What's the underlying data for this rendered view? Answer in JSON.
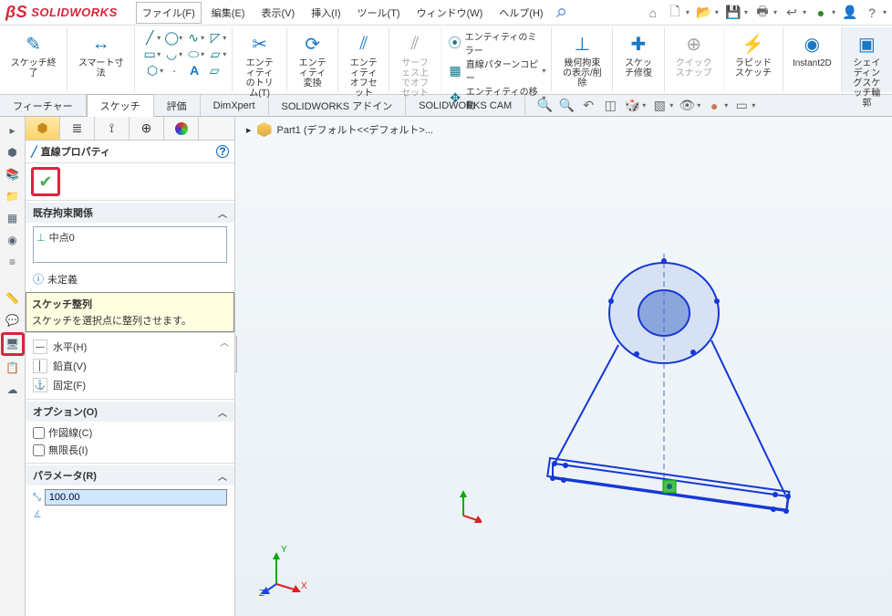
{
  "app": {
    "brand": "SOLIDWORKS"
  },
  "menu": {
    "file": "ファイル(F)",
    "edit": "編集(E)",
    "view": "表示(V)",
    "insert": "挿入(I)",
    "tool": "ツール(T)",
    "window": "ウィンドウ(W)",
    "help": "ヘルプ(H)"
  },
  "ribbon": {
    "sketch_exit": "スケッチ終了",
    "smart_dim": "スマート寸法",
    "trim": "エンティティのトリム(T)",
    "convert": "エンティティ変換",
    "offset": "エンティティオフセット",
    "surf_offset": "サーフェス上でオフセット",
    "mirror": "エンティティのミラー",
    "pattern": "直線パターンコピー",
    "move": "エンティティの移動",
    "constraints": "幾何拘束の表示/削除",
    "repair": "スケッチ修復",
    "quicksnap": "クイックスナップ",
    "rapid": "ラピッドスケッチ",
    "instant2d": "Instant2D",
    "shading": "シェイディングスケッチ輪郭"
  },
  "tabs": {
    "feature": "フィーチャー",
    "sketch": "スケッチ",
    "evaluate": "評価",
    "dimxpert": "DimXpert",
    "addins": "SOLIDWORKS アドイン",
    "cam": "SOLIDWORKS CAM"
  },
  "panel": {
    "title": "直線プロパティ",
    "sec_constraints": "既存拘束関係",
    "constraint_item": "中点0",
    "status": "未定義",
    "tooltip_title": "スケッチ整列",
    "tooltip_body": "スケッチを選択点に整列させます。",
    "align_h": "水平(H)",
    "align_v": "鉛直(V)",
    "align_fix": "固定(F)",
    "options_title": "オプション(O)",
    "opt_construction": "作図線(C)",
    "opt_infinite": "無限長(I)",
    "params_title": "パラメータ(R)",
    "param_len": "100.00"
  },
  "breadcrumb": {
    "part": "Part1 (デフォルト<<デフォルト>..."
  }
}
